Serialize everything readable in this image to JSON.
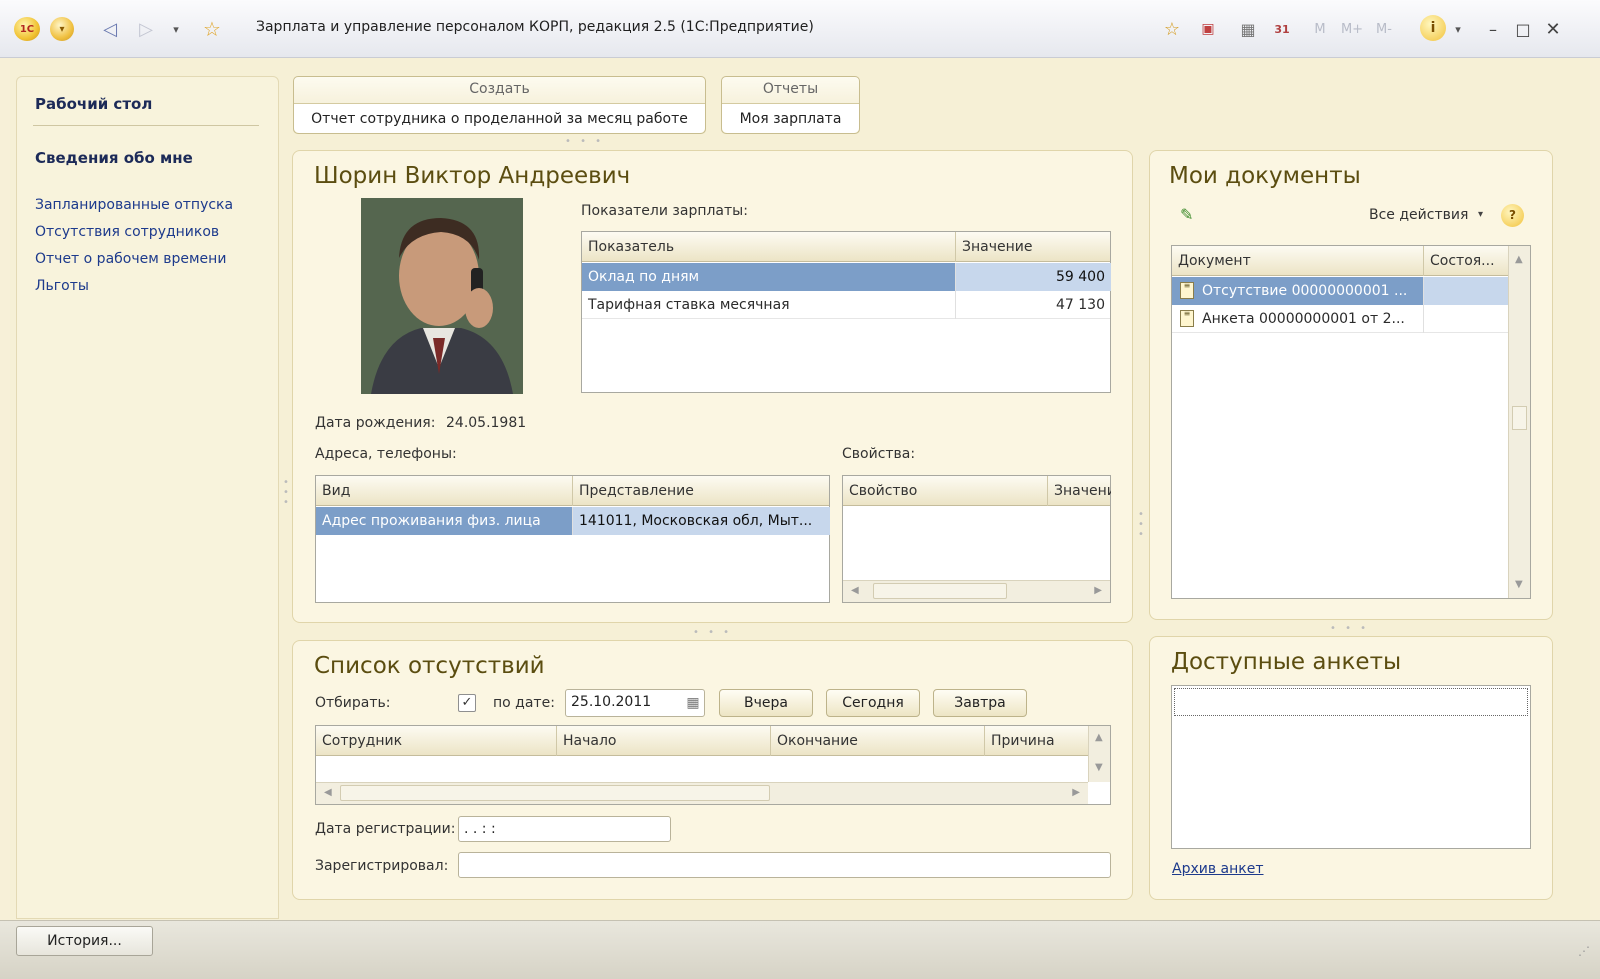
{
  "titlebar": {
    "logo": "1С",
    "title": "Зарплата и управление персоналом КОРП, редакция 2.5  (1С:Предприятие)"
  },
  "nav": {
    "desktop": "Рабочий стол",
    "about_me": "Сведения обо мне",
    "links": [
      "Запланированные отпуска",
      "Отсутствия сотрудников",
      "Отчет о рабочем времени",
      "Льготы"
    ]
  },
  "toolbar": {
    "create_caption": "Создать",
    "create_button": "Отчет сотрудника о проделанной за месяц работе",
    "reports_caption": "Отчеты",
    "reports_button": "Моя зарплата"
  },
  "employee": {
    "name": "Шорин Виктор Андреевич",
    "salary_label": "Показатели зарплаты:",
    "salary_columns": [
      "Показатель",
      "Значение"
    ],
    "salary_rows": [
      {
        "name": "Оклад по дням",
        "value": "59 400"
      },
      {
        "name": "Тарифная ставка месячная",
        "value": "47 130"
      }
    ],
    "birth_label": "Дата рождения:",
    "birth_date": "24.05.1981",
    "contacts_label": "Адреса, телефоны:",
    "contacts_columns": [
      "Вид",
      "Представление"
    ],
    "contacts_rows": [
      {
        "kind": "Адрес проживания физ. лица",
        "repr": "141011, Московская обл, Мыт..."
      }
    ],
    "props_label": "Свойства:",
    "props_columns": [
      "Свойство",
      "Значени"
    ]
  },
  "documents": {
    "title": "Мои документы",
    "all_actions": "Все действия",
    "help": "?",
    "columns": [
      "Документ",
      "Состоя..."
    ],
    "rows": [
      "Отсутствие 00000000001 ...",
      "Анкета 00000000001 от 2..."
    ]
  },
  "absences": {
    "title": "Список отсутствий",
    "filter_label": "Отбирать:",
    "by_date_label": "по дате:",
    "date_value": "25.10.2011",
    "yesterday": "Вчера",
    "today": "Сегодня",
    "tomorrow": "Завтра",
    "columns": [
      "Сотрудник",
      "Начало",
      "Окончание",
      "Причина"
    ],
    "reg_date_label": "Дата регистрации:",
    "reg_date_value": " .  .      :  :",
    "registered_label": "Зарегистрировал:",
    "registered_value": ""
  },
  "forms": {
    "title": "Доступные анкеты",
    "archive_link": "Архив анкет"
  },
  "status": {
    "history_button": "История..."
  },
  "colors": {
    "selection": "#7c9ec8",
    "panel_title": "#5b4d10",
    "link": "#1d3a8c"
  }
}
